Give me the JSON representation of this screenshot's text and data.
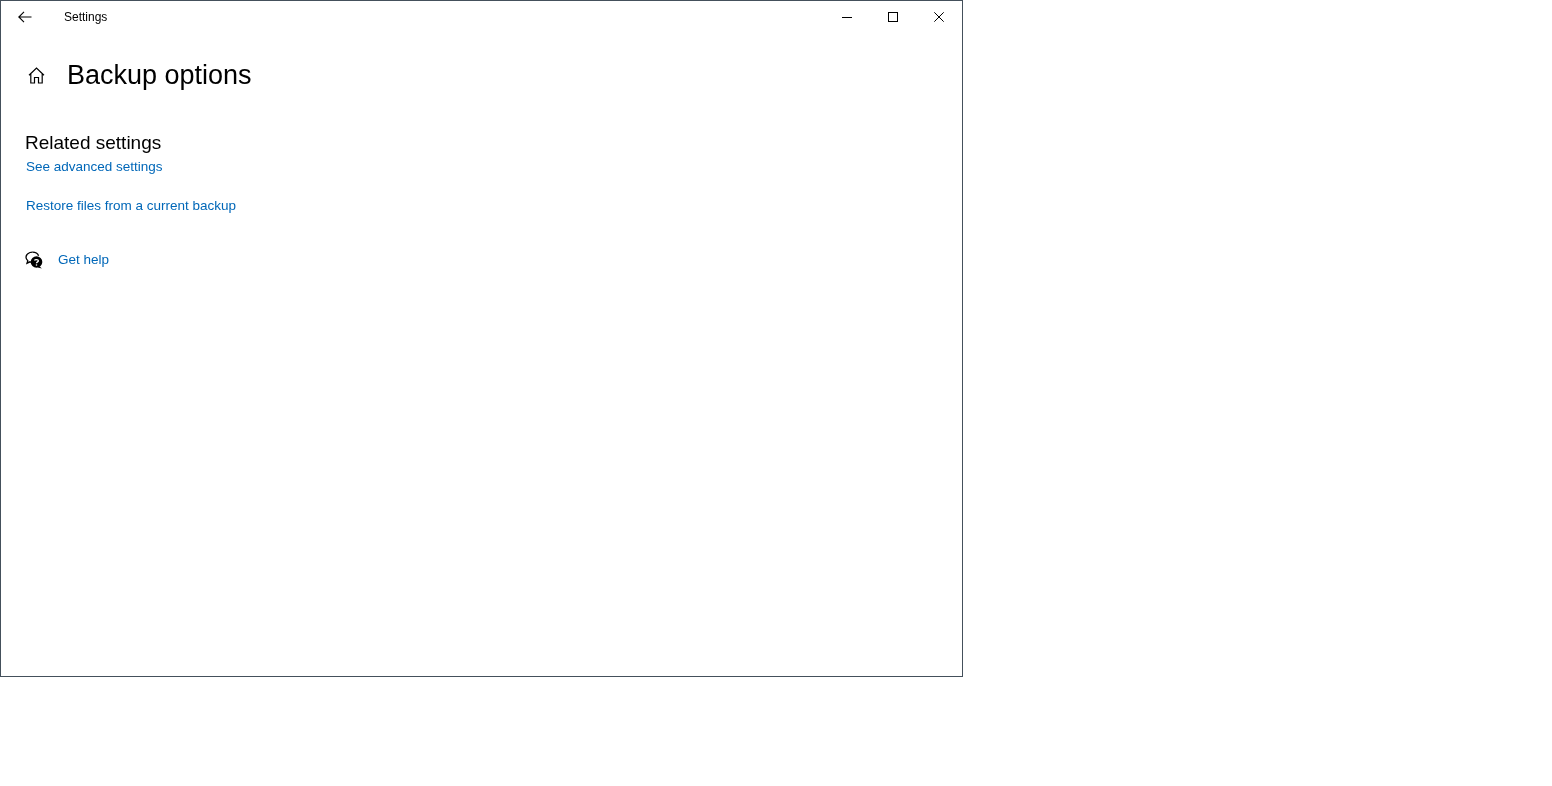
{
  "window": {
    "title": "Settings"
  },
  "page": {
    "title": "Backup options"
  },
  "related_settings": {
    "heading": "Related settings",
    "links": [
      "See advanced settings",
      "Restore files from a current backup"
    ]
  },
  "help": {
    "label": "Get help"
  }
}
